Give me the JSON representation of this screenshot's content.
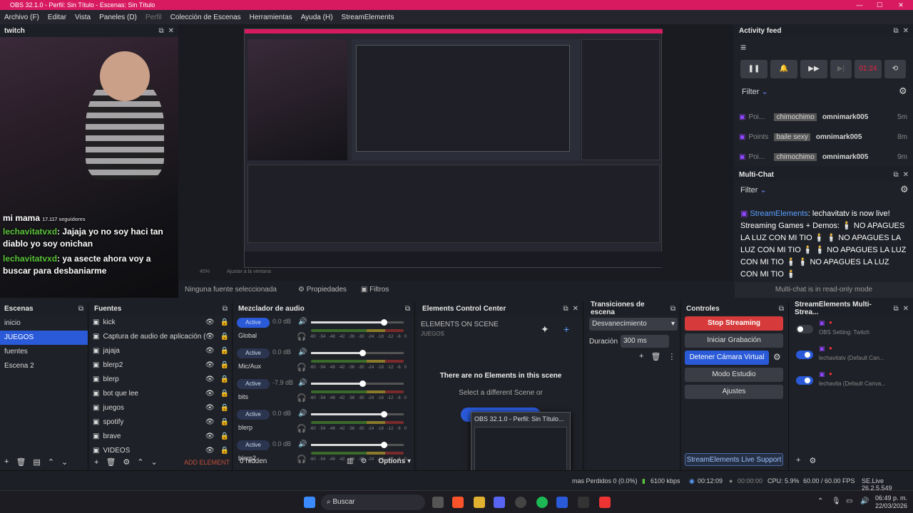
{
  "window": {
    "title": "OBS 32.1.0 - Perfil: Sin Título - Escenas: Sin Título",
    "min": "—",
    "max": "☐",
    "close": "✕"
  },
  "menu": [
    "Archivo (F)",
    "Editar",
    "Vista",
    "Paneles (D)",
    "Perfil",
    "Colección de Escenas",
    "Herramientas",
    "Ayuda (H)",
    "StreamElements"
  ],
  "twitch_dock": {
    "title": "twitch",
    "followers": "17.117 seguidores",
    "chat": [
      {
        "user": "mi mama",
        "text": ""
      },
      {
        "user": "lechavitatvxd",
        "text": ": Jajaja yo no soy haci tan diablo yo soy onichan"
      },
      {
        "user": "lechavitatvxd",
        "text": ": ya asecte ahora voy a buscar para desbaniarme"
      }
    ]
  },
  "preview": {
    "no_source": "Ninguna fuente seleccionada",
    "properties": "Propiedades",
    "filters": "Filtros",
    "zoom": "45%",
    "fit": "Ajustar a la ventana"
  },
  "activity": {
    "title": "Activity feed",
    "timer": "01:24",
    "filter": "Filter",
    "items": [
      {
        "type": "Poi...",
        "tag": "chimochimo",
        "user": "omnimark005",
        "time": "5m"
      },
      {
        "type": "Points",
        "tag": "baile sexy",
        "user": "omnimark005",
        "time": "8m"
      },
      {
        "type": "Poi...",
        "tag": "chimochimo",
        "user": "omnimark005",
        "time": "9m"
      }
    ]
  },
  "multichat": {
    "title": "Multi-Chat",
    "filter": "Filter",
    "user": "StreamElements",
    "message": ": lechavitatv is now live! Streaming Games + Demos: 🕯️ NO APAGUES LA LUZ CON MI TIO 🕯️ 🕯️ NO APAGUES LA LUZ CON MI TIO 🕯️ 🕯️ NO APAGUES LA LUZ CON MI TIO 🕯️ 🕯️ NO APAGUES LA LUZ CON MI TIO 🕯️",
    "readonly": "Multi-chat is in read-only mode"
  },
  "escenas": {
    "title": "Escenas",
    "items": [
      "inicio",
      "JUEGOS",
      "fuentes",
      "Escena 2"
    ],
    "selected": 1
  },
  "fuentes": {
    "title": "Fuentes",
    "items": [
      "kick",
      "Captura de audio de aplicación (E",
      "jajaja",
      "blerp2",
      "blerp",
      "bot que lee",
      "juegos",
      "spotify",
      "brave",
      "VIDEOS"
    ],
    "add": "ADD ELEMENT"
  },
  "mezclador": {
    "title": "Mezclador de audio",
    "channels": [
      {
        "name": "Global",
        "db": "0.0 dB",
        "level": 0.85
      },
      {
        "name": "Mic/Aux",
        "db": "0.0 dB",
        "level": 0.6
      },
      {
        "name": "bits",
        "db": "-7.9 dB",
        "level": 0.6
      },
      {
        "name": "blerp",
        "db": "0.0 dB",
        "level": 0.85
      },
      {
        "name": "blerp2",
        "db": "0.0 dB",
        "level": 0.85
      },
      {
        "name": "",
        "db": "0.0 dB",
        "level": 0.0
      }
    ],
    "active": "Active",
    "ticks": [
      "-60",
      "-54",
      "-48",
      "-42",
      "-36",
      "-30",
      "-24",
      "-18",
      "-12",
      "-6",
      "0"
    ],
    "hidden": "0 hidden",
    "options": "Options"
  },
  "ecc": {
    "title": "Elements Control Center",
    "heading": "ELEMENTS ON SCENE",
    "scene": "JUEGOS",
    "empty": "There are no Elements in this scene",
    "select": "Select a different Scene or",
    "tooltip": "OBS 32.1.0 - Perfil: Sin Título..."
  },
  "transiciones": {
    "title": "Transiciones de escena",
    "type": "Desvanecimiento",
    "duration_label": "Duración",
    "duration": "300 ms"
  },
  "controles": {
    "title": "Controles",
    "stop": "Stop Streaming",
    "record": "Iniciar Grabación",
    "vcam": "Detener Cámara Virtual",
    "studio": "Modo Estudio",
    "settings": "Ajustes",
    "live": "StreamElements Live Support"
  },
  "multistream": {
    "title": "StreamElements Multi-Strea...",
    "items": [
      {
        "name": "OBS Setting: Twitch",
        "on": false
      },
      {
        "name": "lechavitatv (Default Can...",
        "on": true
      },
      {
        "name": "lechavita (Default Canva...",
        "on": true
      }
    ]
  },
  "status": {
    "frames": "mas Perdidos 0 (0.0%)",
    "kbps": "6100 kbps",
    "live": "00:12:09",
    "rec": "00:00:00",
    "cpu": "CPU: 5.9%",
    "fps": "60.00 / 60.00 FPS",
    "se": "SE.Live 26.2.5.549"
  },
  "taskbar": {
    "search": "Buscar",
    "time": "06:49 p. m.",
    "date": "22/03/2026"
  },
  "colors": {
    "accent": "#d81b60",
    "blue": "#2a5ad8",
    "red": "#d63a3a",
    "green": "#5ac43a",
    "purple": "#9146ff"
  }
}
